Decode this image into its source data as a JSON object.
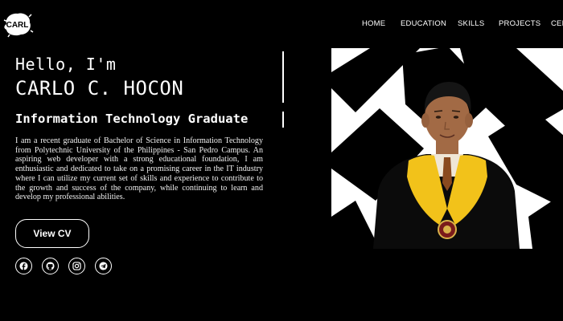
{
  "logo": {
    "text": "CARL",
    "icon": "brush-splash-logo"
  },
  "nav": {
    "items": [
      {
        "label": "HOME"
      },
      {
        "label": "EDUCATION"
      },
      {
        "label": "SKILLS"
      },
      {
        "label": "PROJECTS"
      },
      {
        "label": "CER"
      }
    ]
  },
  "hero": {
    "greeting": "Hello, I'm",
    "name": "CARLO C. HOCON",
    "role": "Information Technology Graduate",
    "bio": "I am a recent graduate of Bachelor of Science in Information Technology from Polytechnic University of the Philippines - San Pedro Campus. An aspiring web developer with a strong educational foundation, I am enthusiastic and dedicated to take on a promising career in the IT industry where I can utilize my current set of skills and experience to contribute to the growth and success of the company, while continuing to learn and develop my professional abilities.",
    "cv_button": "View CV"
  },
  "socials": [
    {
      "icon": "facebook-icon"
    },
    {
      "icon": "github-icon"
    },
    {
      "icon": "instagram-icon"
    },
    {
      "icon": "telegram-icon"
    }
  ],
  "portrait": {
    "subject": "graduate in black toga with yellow stole",
    "background": "black geometric diamond pattern on white"
  },
  "colors": {
    "background": "#000000",
    "text": "#ffffff",
    "stole": "#f2c21a",
    "skin": "#a26a45"
  }
}
